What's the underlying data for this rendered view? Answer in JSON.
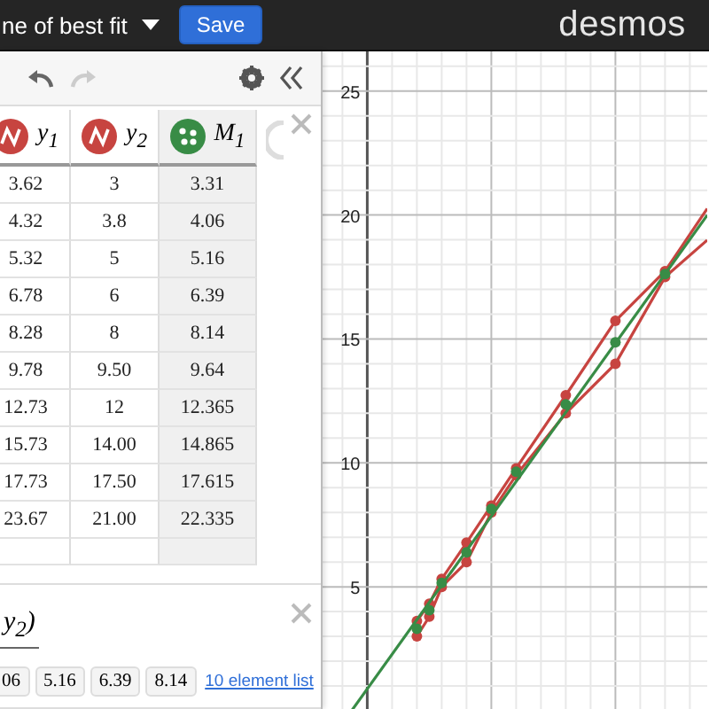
{
  "header": {
    "title": "ne of best fit",
    "save": "Save",
    "logo": "desmos"
  },
  "table": {
    "columns": [
      {
        "label": "y$_{1}$",
        "kind": "lines",
        "color": "#c74440"
      },
      {
        "label": "y$_{2}$",
        "kind": "lines",
        "color": "#c74440"
      },
      {
        "label": "M$_{1}$",
        "kind": "points",
        "color": "#388c46"
      }
    ],
    "rows": [
      [
        "3.62",
        "3",
        "3.31"
      ],
      [
        "4.32",
        "3.8",
        "4.06"
      ],
      [
        "5.32",
        "5",
        "5.16"
      ],
      [
        "6.78",
        "6",
        "6.39"
      ],
      [
        "8.28",
        "8",
        "8.14"
      ],
      [
        "9.78",
        "9.50",
        "9.64"
      ],
      [
        "12.73",
        "12",
        "12.365"
      ],
      [
        "15.73",
        "14.00",
        "14.865"
      ],
      [
        "17.73",
        "17.50",
        "17.615"
      ],
      [
        "23.67",
        "21.00",
        "22.335"
      ]
    ]
  },
  "list": {
    "formula": "y$_{2}$)",
    "chips": [
      "06",
      "5.16",
      "6.39",
      "8.14"
    ],
    "link": "10 element list"
  },
  "graph": {
    "axis_labels": [
      "25",
      "20",
      "15",
      "10",
      "5"
    ]
  }
}
